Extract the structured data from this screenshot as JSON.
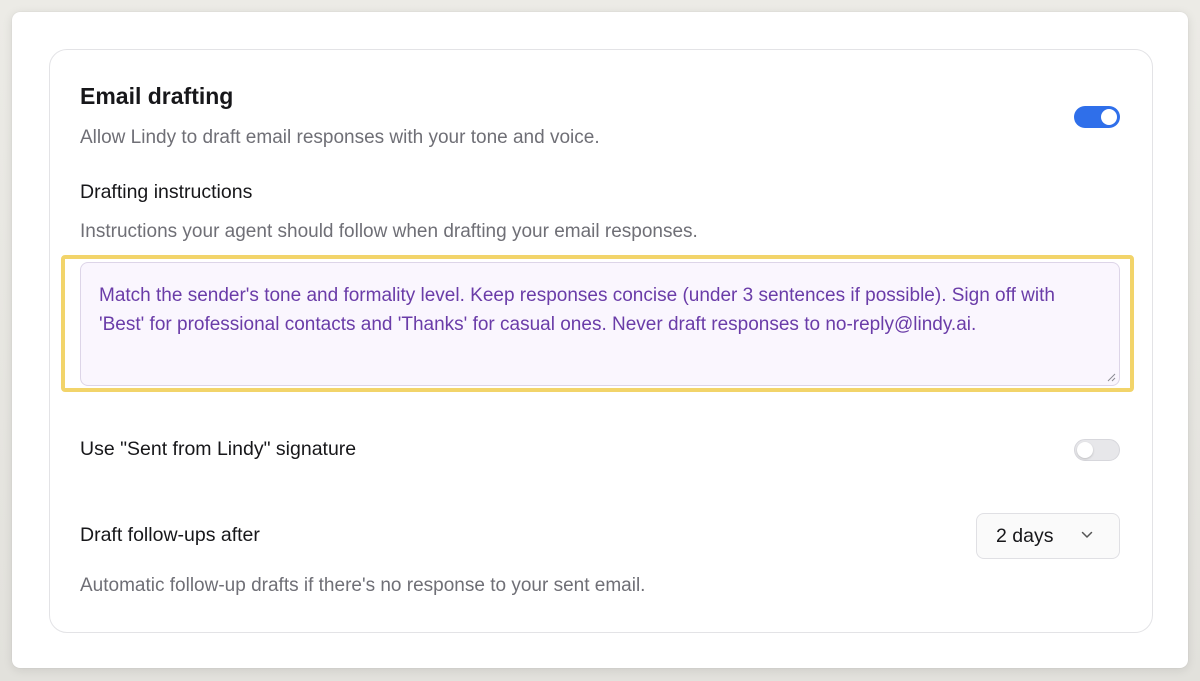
{
  "email_drafting": {
    "title": "Email drafting",
    "description": "Allow Lindy to draft email responses with your tone and voice.",
    "enabled": true
  },
  "drafting_instructions": {
    "label": "Drafting instructions",
    "description": "Instructions your agent should follow when drafting your email responses.",
    "value": "Match the sender's tone and formality level. Keep responses concise (under 3 sentences if possible). Sign off with 'Best' for professional contacts and 'Thanks' for casual ones. Never draft responses to no-reply@lindy.ai."
  },
  "signature": {
    "label": "Use \"Sent from Lindy\" signature",
    "enabled": false
  },
  "follow_ups": {
    "label": "Draft follow-ups after",
    "selected": "2 days",
    "description": "Automatic follow-up drafts if there's no response to your sent email."
  },
  "colors": {
    "toggle_on": "#2f6fea",
    "toggle_off": "#e7e7ea",
    "highlight": "#f2d46a",
    "instruction_text": "#6a3ca8",
    "instruction_bg": "#faf6fe"
  },
  "icons": {
    "dropdown": "chevron-down-icon",
    "resize": "resize-handle-icon"
  }
}
